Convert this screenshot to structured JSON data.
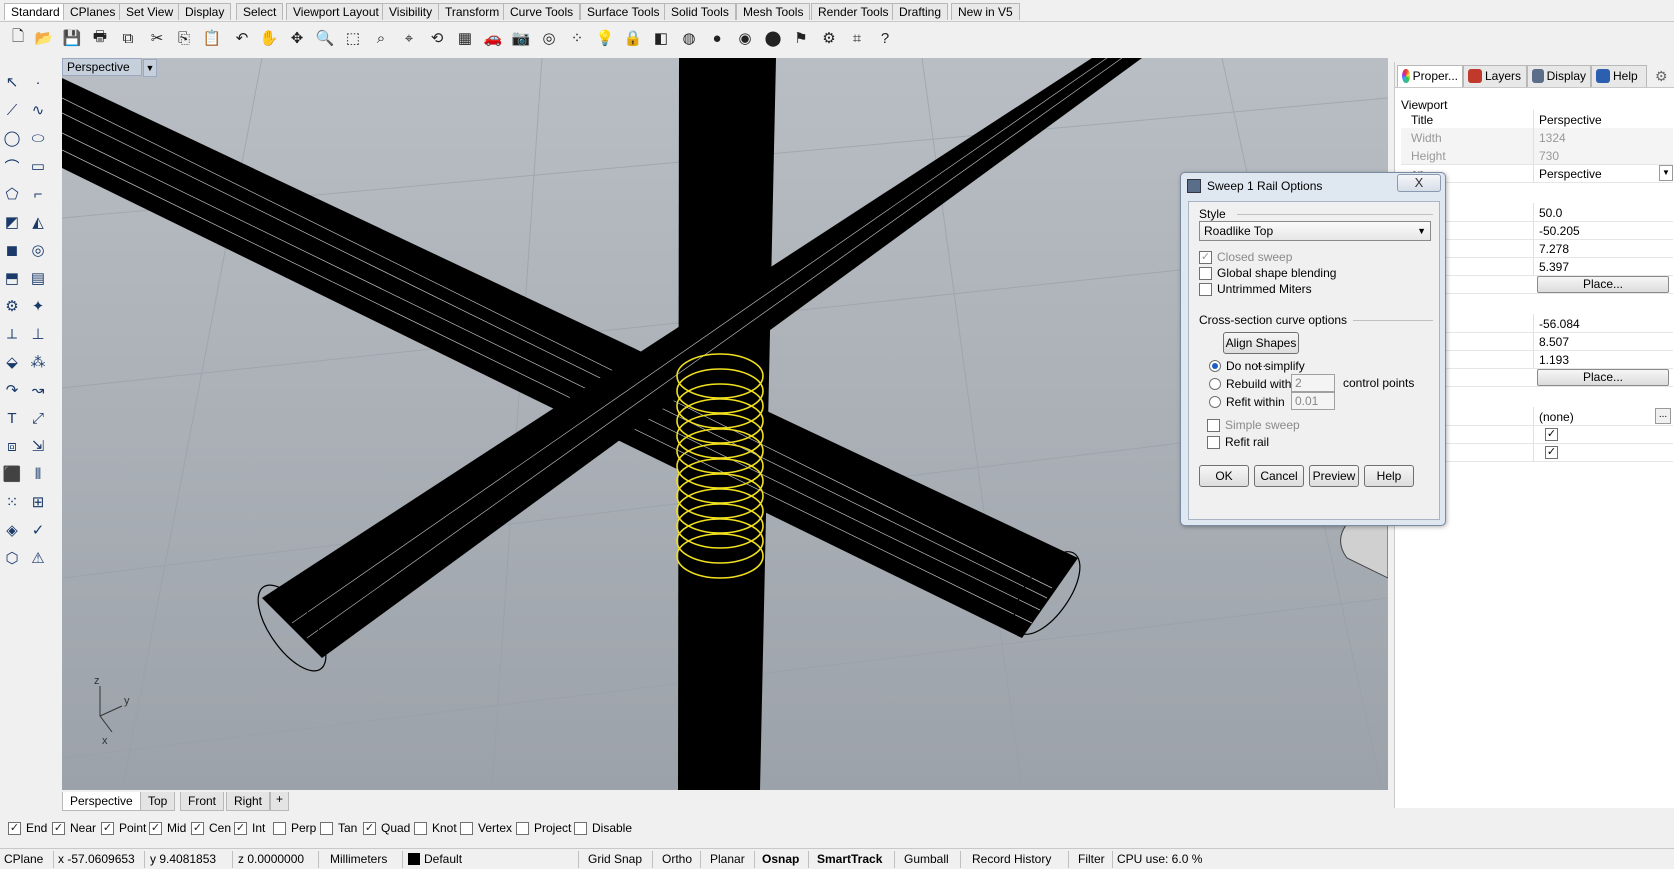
{
  "top_tabs": [
    "Standard",
    "CPlanes",
    "Set View",
    "Display",
    "Select",
    "Viewport Layout",
    "Visibility",
    "Transform",
    "Curve Tools",
    "Surface Tools",
    "Solid Tools",
    "Mesh Tools",
    "Render Tools",
    "Drafting",
    "New in V5"
  ],
  "viewport": {
    "title": "Perspective",
    "axes": {
      "z": "z",
      "y": "y",
      "x": "x"
    }
  },
  "viewport_tabs": [
    "Perspective",
    "Top",
    "Front",
    "Right"
  ],
  "osnaps": [
    {
      "label": "End",
      "checked": true
    },
    {
      "label": "Near",
      "checked": true
    },
    {
      "label": "Point",
      "checked": true
    },
    {
      "label": "Mid",
      "checked": true
    },
    {
      "label": "Cen",
      "checked": true
    },
    {
      "label": "Int",
      "checked": true
    },
    {
      "label": "Perp",
      "checked": false
    },
    {
      "label": "Tan",
      "checked": false
    },
    {
      "label": "Quad",
      "checked": true
    },
    {
      "label": "Knot",
      "checked": false
    },
    {
      "label": "Vertex",
      "checked": false
    },
    {
      "label": "Project",
      "checked": false
    },
    {
      "label": "Disable",
      "checked": false
    }
  ],
  "status": {
    "cplane": "CPlane",
    "x": "x -57.0609653",
    "y": "y 9.4081853",
    "z": "z 0.0000000",
    "units": "Millimeters",
    "layer": "Default",
    "grid_snap": "Grid Snap",
    "ortho": "Ortho",
    "planar": "Planar",
    "osnap": "Osnap",
    "smarttrack": "SmartTrack",
    "gumball": "Gumball",
    "record_history": "Record History",
    "filter": "Filter",
    "cpu": "CPU use: 6.0 %"
  },
  "right_panel": {
    "tabs": [
      "Proper...",
      "Layers",
      "Display",
      "Help"
    ],
    "section": "Viewport",
    "rows": [
      {
        "key": "Title",
        "value": "Perspective"
      },
      {
        "key": "Width",
        "value": "1324"
      },
      {
        "key": "Height",
        "value": "730"
      },
      {
        "key": "on",
        "value": "Perspective"
      },
      {
        "key": "ngth",
        "value": "50.0"
      },
      {
        "key": "ion",
        "value": "-50.205"
      },
      {
        "key": "ion",
        "value": "7.278"
      },
      {
        "key": "ion",
        "value": "5.397"
      },
      {
        "key": "n",
        "value": "Place..."
      },
      {
        "key": "t",
        "value": "-56.084"
      },
      {
        "key": "t",
        "value": "8.507"
      },
      {
        "key": "t",
        "value": "1.193"
      },
      {
        "key": "n",
        "value": "Place..."
      },
      {
        "key": "e",
        "value": "(none)"
      }
    ]
  },
  "dialog": {
    "title": "Sweep 1 Rail Options",
    "close": "X",
    "style_label": "Style",
    "style_value": "Roadlike Top",
    "closed_sweep": "Closed sweep",
    "global_blending": "Global shape blending",
    "untrimmed_miters": "Untrimmed Miters",
    "cross_section_label": "Cross-section curve options",
    "align_shapes": "Align Shapes ...",
    "do_not_simplify": "Do not simplify",
    "rebuild_with": "Rebuild with",
    "rebuild_value": "2",
    "control_points": "control points",
    "refit_within": "Refit within",
    "refit_value": "0.01",
    "simple_sweep": "Simple sweep",
    "refit_rail": "Refit rail",
    "ok": "OK",
    "cancel": "Cancel",
    "preview": "Preview",
    "help": "Help"
  }
}
